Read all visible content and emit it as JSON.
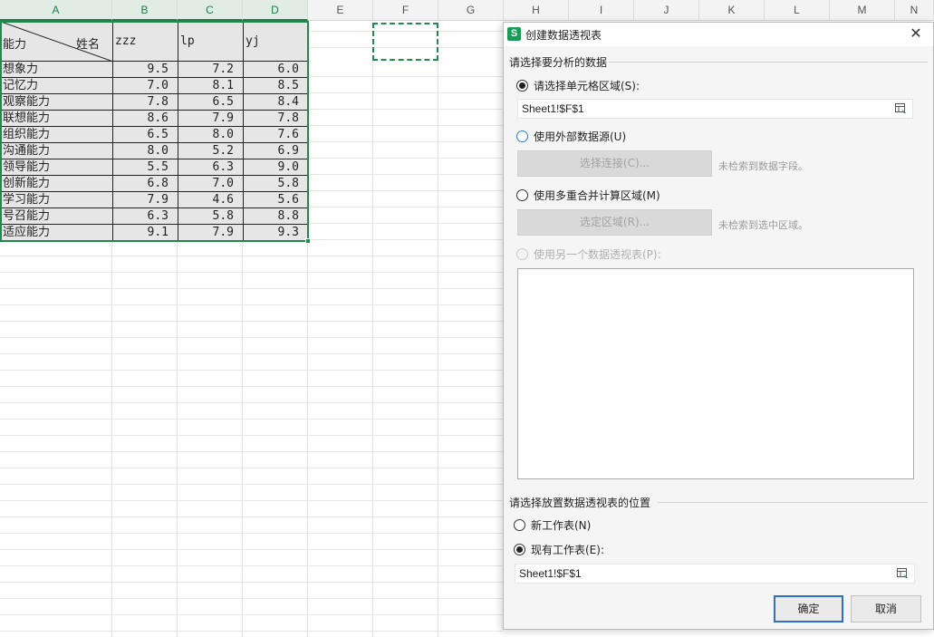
{
  "columns": [
    "A",
    "B",
    "C",
    "D",
    "E",
    "F",
    "G",
    "H",
    "I",
    "J",
    "K",
    "L",
    "M",
    "N"
  ],
  "table": {
    "corner_left": "能力",
    "corner_right": "姓名",
    "headers": [
      "zzz",
      "lp",
      "yj"
    ],
    "rows": [
      {
        "label": "想象力",
        "values": [
          "9.5",
          "7.2",
          "6.0"
        ]
      },
      {
        "label": "记忆力",
        "values": [
          "7.0",
          "8.1",
          "8.5"
        ]
      },
      {
        "label": "观察能力",
        "values": [
          "7.8",
          "6.5",
          "8.4"
        ]
      },
      {
        "label": "联想能力",
        "values": [
          "8.6",
          "7.9",
          "7.8"
        ]
      },
      {
        "label": "组织能力",
        "values": [
          "6.5",
          "8.0",
          "7.6"
        ]
      },
      {
        "label": "沟通能力",
        "values": [
          "8.0",
          "5.2",
          "6.9"
        ]
      },
      {
        "label": "领导能力",
        "values": [
          "5.5",
          "6.3",
          "9.0"
        ]
      },
      {
        "label": "创新能力",
        "values": [
          "6.8",
          "7.0",
          "5.8"
        ]
      },
      {
        "label": "学习能力",
        "values": [
          "7.9",
          "4.6",
          "5.6"
        ]
      },
      {
        "label": "号召能力",
        "values": [
          "6.3",
          "5.8",
          "8.8"
        ]
      },
      {
        "label": "适应能力",
        "values": [
          "9.1",
          "7.9",
          "9.3"
        ]
      }
    ]
  },
  "dialog": {
    "app_icon": "S",
    "title": "创建数据透视表",
    "close": "✕",
    "section_source": "请选择要分析的数据",
    "opt_range": "请选择单元格区域(S):",
    "range_value": "Sheet1!$F$1",
    "opt_external": "使用外部数据源(U)",
    "btn_choose_conn": "选择连接(C)...",
    "hint_no_fields": "未检索到数据字段。",
    "opt_multi": "使用多重合并计算区域(M)",
    "btn_select_range": "选定区域(R)...",
    "hint_no_range": "未检索到选中区域。",
    "opt_other_pivot": "使用另一个数据透视表(P):",
    "section_location": "请选择放置数据透视表的位置",
    "opt_new_sheet": "新工作表(N)",
    "opt_existing_sheet": "现有工作表(E):",
    "location_value": "Sheet1!$F$1",
    "ok": "确定",
    "cancel": "取消"
  },
  "colors": {
    "accent_green": "#1f8a4c",
    "primary_border": "#2f6fbf"
  },
  "icons": [
    "range-picker-icon",
    "close-icon",
    "wps-spreadsheet-icon"
  ]
}
